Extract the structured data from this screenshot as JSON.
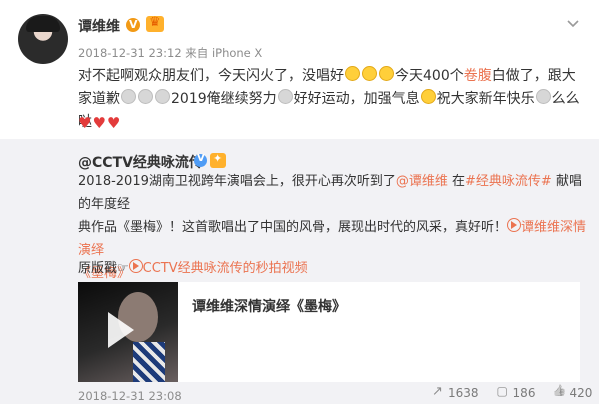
{
  "post": {
    "username": "谭维维",
    "meta": "2018-12-31 23:12 来自 iPhone X",
    "text_line1_a": "对不起啊观众朋友们，今天闪火了，没唱好",
    "text_line1_b": "今天400个",
    "text_line1_red": "卷腹",
    "text_line1_c": "白做了，跟大",
    "text_line2_a": "家道歉",
    "text_line2_b": "2019俺继续努力",
    "text_line2_c": "好好运动，加强气息",
    "text_line2_d": "祝大家新年快乐",
    "text_line2_e": "么么哒",
    "hearts": "♥♥♥"
  },
  "repost": {
    "username": "@CCTV经典咏流传",
    "line1_a": "2018-2019湖南卫视跨年演唱会上，很开心再次听到了",
    "line1_link1": "@谭维维",
    "line1_b": " 在",
    "line1_link2": "#经典咏流传#",
    "line1_c": " 献唱的年度经",
    "line2_a": "典作品《墨梅》！这首歌唱出了中国的风骨，展现出时代的风采，真好听！",
    "line2_link": "谭维维深情演绎",
    "line3_link": "《墨梅》",
    "origin_label": "原版戳☞",
    "origin_link": "CCTV经典咏流传的秒拍视频",
    "video_title": "谭维维深情演绎《墨梅》",
    "footer_time": "2018-12-31 23:08"
  },
  "actions": {
    "share_count": "1638",
    "comment_count": "186",
    "like_count": "420"
  }
}
